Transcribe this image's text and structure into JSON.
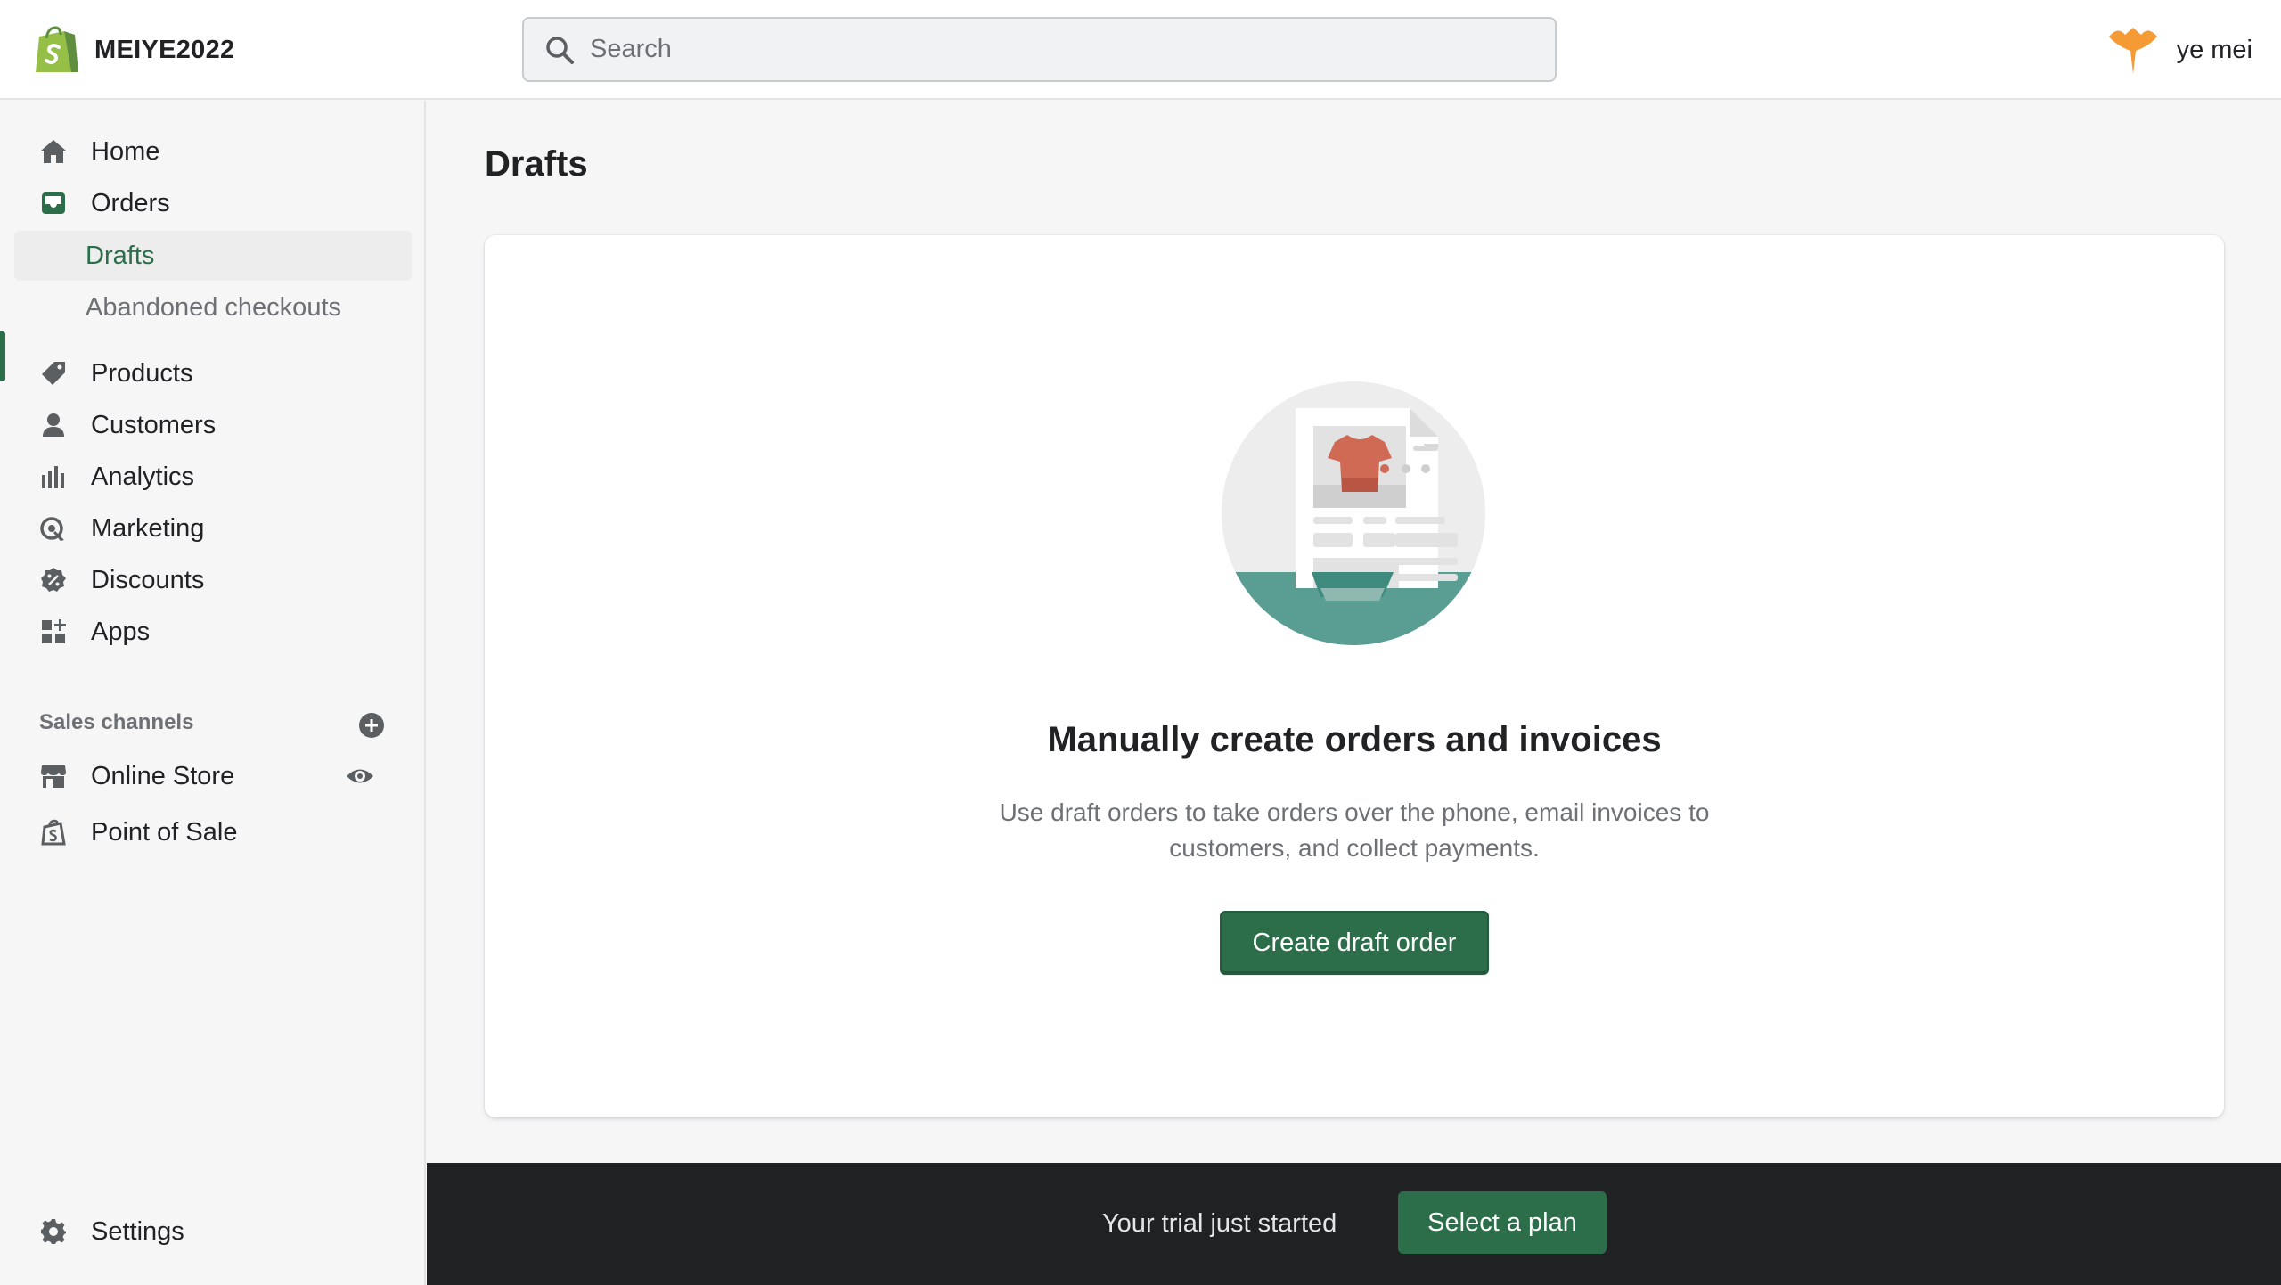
{
  "topbar": {
    "store_name": "MEIYE2022",
    "search_placeholder": "Search",
    "user_name": "ye mei"
  },
  "sidebar": {
    "items": [
      {
        "label": "Home",
        "icon": "home-icon"
      },
      {
        "label": "Orders",
        "icon": "orders-icon"
      },
      {
        "label": "Drafts",
        "icon": ""
      },
      {
        "label": "Abandoned checkouts",
        "icon": ""
      },
      {
        "label": "Products",
        "icon": "tag-icon"
      },
      {
        "label": "Customers",
        "icon": "customer-icon"
      },
      {
        "label": "Analytics",
        "icon": "analytics-icon"
      },
      {
        "label": "Marketing",
        "icon": "marketing-icon"
      },
      {
        "label": "Discounts",
        "icon": "discount-icon"
      },
      {
        "label": "Apps",
        "icon": "apps-icon"
      }
    ],
    "sales_channels_label": "Sales channels",
    "channels": [
      {
        "label": "Online Store",
        "icon": "store-icon"
      },
      {
        "label": "Point of Sale",
        "icon": "pos-icon"
      }
    ],
    "settings_label": "Settings"
  },
  "main": {
    "title": "Drafts",
    "empty_state": {
      "heading": "Manually create orders and invoices",
      "description": "Use draft orders to take orders over the phone, email invoices to customers, and collect payments.",
      "button_label": "Create draft order"
    }
  },
  "trial": {
    "text": "Your trial just started",
    "button_label": "Select a plan"
  },
  "colors": {
    "primary": "#2c6e49",
    "sidebar_bg": "#f6f6f7",
    "trial_bg": "#202123",
    "avatar": "#f49b35",
    "logo_green": "#95bf47"
  }
}
